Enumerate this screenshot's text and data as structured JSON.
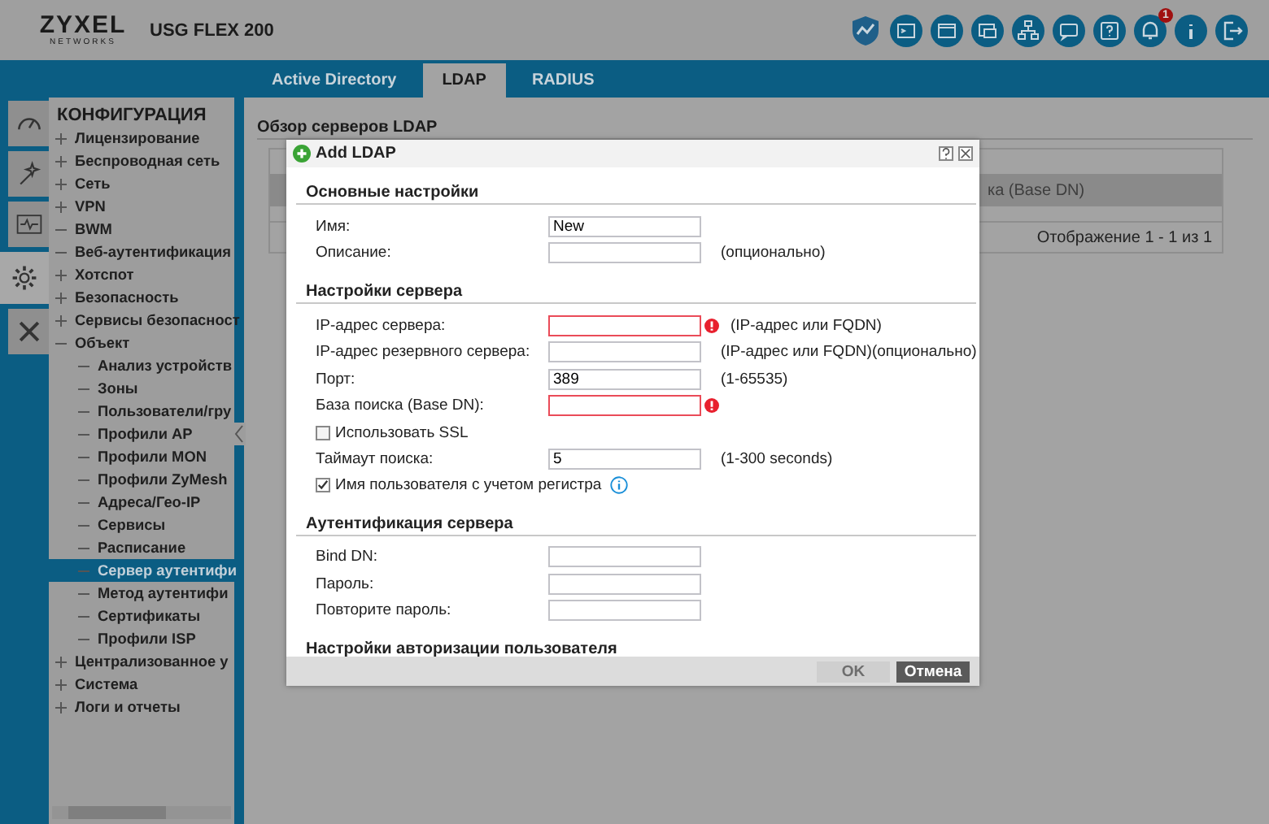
{
  "header": {
    "brand": "ZYXEL",
    "brand_sub": "NETWORKS",
    "model": "USG FLEX 200",
    "notification_count": "1"
  },
  "tabs": [
    {
      "label": "Active Directory",
      "selected": false
    },
    {
      "label": "LDAP",
      "selected": true
    },
    {
      "label": "RADIUS",
      "selected": false
    }
  ],
  "side_icons": [
    {
      "kind": "dashboard",
      "selected": false
    },
    {
      "kind": "wizard",
      "selected": false
    },
    {
      "kind": "monitor",
      "selected": false
    },
    {
      "kind": "configuration",
      "selected": true
    },
    {
      "kind": "maintenance",
      "selected": false
    }
  ],
  "nav": {
    "title": "КОНФИГУРАЦИЯ",
    "items": [
      {
        "kind": "group",
        "label": "Лицензирование",
        "expanded": false
      },
      {
        "kind": "group",
        "label": "Беспроводная сеть",
        "expanded": false
      },
      {
        "kind": "group",
        "label": "Сеть",
        "expanded": false
      },
      {
        "kind": "group",
        "label": "VPN",
        "expanded": false
      },
      {
        "kind": "leaf",
        "label": "BWM"
      },
      {
        "kind": "leaf",
        "label": "Веб-аутентификация"
      },
      {
        "kind": "group",
        "label": "Хотспот",
        "expanded": false
      },
      {
        "kind": "group",
        "label": "Безопасность",
        "expanded": false
      },
      {
        "kind": "group",
        "label": "Сервисы безопасност",
        "expanded": false
      },
      {
        "kind": "group",
        "label": "Объект",
        "expanded": true,
        "children": [
          {
            "label": "Анализ устройств",
            "selected": false
          },
          {
            "label": "Зоны",
            "selected": false
          },
          {
            "label": "Пользователи/гру",
            "selected": false
          },
          {
            "label": "Профили AP",
            "selected": false
          },
          {
            "label": "Профили MON",
            "selected": false
          },
          {
            "label": "Профили ZyMesh",
            "selected": false
          },
          {
            "label": "Адреса/Гео-IP",
            "selected": false
          },
          {
            "label": "Сервисы",
            "selected": false
          },
          {
            "label": "Расписание",
            "selected": false
          },
          {
            "label": "Сервер аутентифи",
            "selected": true
          },
          {
            "label": "Метод аутентифи",
            "selected": false
          },
          {
            "label": "Сертификаты",
            "selected": false
          },
          {
            "label": "Профили ISP",
            "selected": false
          }
        ]
      },
      {
        "kind": "group",
        "label": "Централизованное у",
        "expanded": false
      },
      {
        "kind": "group",
        "label": "Система",
        "expanded": false
      },
      {
        "kind": "group",
        "label": "Логи и отчеты",
        "expanded": false
      }
    ]
  },
  "main": {
    "section_title": "Обзор серверов LDAP",
    "column_visible": "ка (Base DN)",
    "pager": "Отображение 1 - 1 из 1"
  },
  "dialog": {
    "title": "Add LDAP",
    "sections": [
      {
        "title": "Основные настройки",
        "rows": [
          {
            "kind": "field",
            "label": "Имя:",
            "value": "New",
            "error": false
          },
          {
            "kind": "field",
            "label": "Описание:",
            "error": false,
            "hint": "(опционально)"
          }
        ]
      },
      {
        "title": "Настройки сервера",
        "rows": [
          {
            "kind": "field",
            "label": "IP-адрес сервера:",
            "error": true,
            "hint": "(IP-адрес или FQDN)"
          },
          {
            "kind": "field",
            "label": "IP-адрес резервного сервера:",
            "error": false,
            "hint": "(IP-адрес или FQDN)(опционально)"
          },
          {
            "kind": "field",
            "label": "Порт:",
            "value": "389",
            "error": false,
            "hint": "(1-65535)"
          },
          {
            "kind": "field",
            "label": "База поиска (Base DN):",
            "error": true
          },
          {
            "kind": "checkbox",
            "label": "Использовать SSL",
            "checked": false,
            "info": false
          },
          {
            "kind": "field",
            "label": "Таймаут поиска:",
            "value": "5",
            "error": false,
            "hint": "(1-300 seconds)"
          },
          {
            "kind": "checkbox",
            "label": "Имя пользователя с учетом регистра",
            "checked": true,
            "info": true
          }
        ]
      },
      {
        "title": "Аутентификация сервера",
        "rows": [
          {
            "kind": "field",
            "label": "Bind DN:",
            "error": false
          },
          {
            "kind": "field",
            "label": "Пароль:",
            "error": false
          },
          {
            "kind": "field",
            "label": "Повторите пароль:",
            "error": false
          }
        ]
      },
      {
        "title": "Настройки авторизации пользователя"
      }
    ],
    "buttons": [
      {
        "label": "OK",
        "disabled": true
      },
      {
        "label": "Отмена",
        "disabled": false
      }
    ]
  }
}
